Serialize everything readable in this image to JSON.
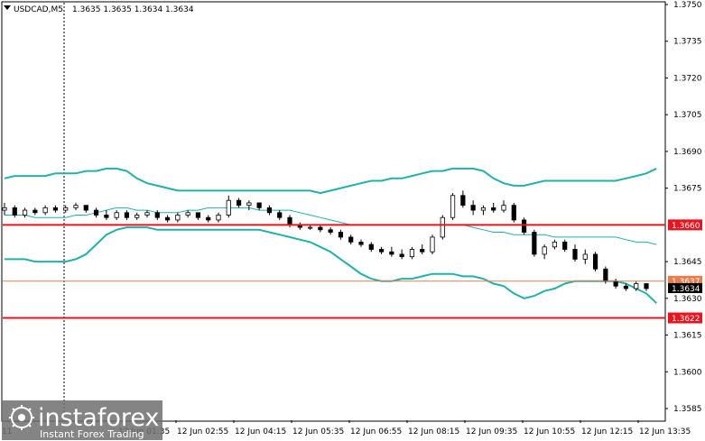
{
  "chart_data": {
    "type": "candlestick",
    "symbol_header": "USDCAD,M5",
    "ohlc_header": "1.3635 1.3635 1.3634 1.3634",
    "y_ticks": [
      "1.3750",
      "1.3735",
      "1.3720",
      "1.3705",
      "1.3690",
      "1.3675",
      "1.3660",
      "1.3645",
      "1.3630",
      "1.3615",
      "1.3600",
      "1.3585"
    ],
    "ylim": [
      1.358,
      1.3752
    ],
    "x_ticks": [
      "12 Jun 02:55",
      "12 Jun 04:15",
      "12 Jun 05:35",
      "12 Jun 06:55",
      "12 Jun 08:15",
      "12 Jun 09:35",
      "12 Jun 10:55",
      "12 Jun 12:15",
      "12 Jun 13:35"
    ],
    "x_ticks_partial": [
      "11",
      "12 Jun 01:35"
    ],
    "levels": [
      {
        "value": 1.366,
        "label": "1.3660",
        "color": "#e8141e"
      },
      {
        "value": 1.3622,
        "label": "1.3622",
        "color": "#e8141e"
      }
    ],
    "current_levels": [
      {
        "value": 1.3637,
        "label": "1.3637",
        "color": "#e67e50"
      },
      {
        "value": 1.3634,
        "label": "1.3634",
        "color": "#000000"
      }
    ],
    "bollinger": {
      "color": "#20b2a8",
      "upper": [
        1.3679,
        1.368,
        1.368,
        1.368,
        1.368,
        1.3681,
        1.3681,
        1.3681,
        1.3682,
        1.3682,
        1.3683,
        1.3683,
        1.3682,
        1.3679,
        1.3677,
        1.3676,
        1.3675,
        1.3674,
        1.3674,
        1.3674,
        1.3674,
        1.3674,
        1.3674,
        1.3674,
        1.3674,
        1.3674,
        1.3674,
        1.3674,
        1.3674,
        1.3674,
        1.3674,
        1.3673,
        1.3674,
        1.3675,
        1.3676,
        1.3677,
        1.3678,
        1.3678,
        1.3679,
        1.3679,
        1.368,
        1.3681,
        1.3682,
        1.3682,
        1.3683,
        1.3683,
        1.3683,
        1.3682,
        1.3679,
        1.3677,
        1.3676,
        1.3676,
        1.3677,
        1.3678,
        1.3678,
        1.3678,
        1.3678,
        1.3678,
        1.3678,
        1.3678,
        1.3678,
        1.3679,
        1.368,
        1.3681,
        1.3683
      ],
      "middle": [
        1.3664,
        1.3664,
        1.3664,
        1.3663,
        1.3663,
        1.3663,
        1.3663,
        1.3664,
        1.3664,
        1.3665,
        1.3666,
        1.3667,
        1.3667,
        1.3666,
        1.3666,
        1.3665,
        1.3665,
        1.3665,
        1.3666,
        1.3666,
        1.3667,
        1.3667,
        1.3667,
        1.3667,
        1.3667,
        1.3666,
        1.3666,
        1.3666,
        1.3666,
        1.3665,
        1.3664,
        1.3663,
        1.3662,
        1.3661,
        1.366,
        1.366,
        1.366,
        1.366,
        1.366,
        1.366,
        1.366,
        1.366,
        1.366,
        1.366,
        1.366,
        1.366,
        1.3659,
        1.3658,
        1.3657,
        1.3657,
        1.3656,
        1.3656,
        1.3656,
        1.3656,
        1.3655,
        1.3655,
        1.3655,
        1.3655,
        1.3655,
        1.3655,
        1.3655,
        1.3654,
        1.3653,
        1.3653,
        1.3652
      ],
      "lower": [
        1.3646,
        1.3646,
        1.3646,
        1.3645,
        1.3645,
        1.3645,
        1.3645,
        1.3646,
        1.3648,
        1.3652,
        1.3656,
        1.3658,
        1.3659,
        1.3659,
        1.3659,
        1.3658,
        1.3658,
        1.3658,
        1.3658,
        1.3658,
        1.3658,
        1.3658,
        1.3658,
        1.3658,
        1.3658,
        1.3658,
        1.3657,
        1.3656,
        1.3655,
        1.3654,
        1.3653,
        1.3651,
        1.3649,
        1.3646,
        1.3643,
        1.364,
        1.3638,
        1.3637,
        1.3637,
        1.3638,
        1.3638,
        1.3639,
        1.364,
        1.364,
        1.364,
        1.3639,
        1.3639,
        1.3638,
        1.3636,
        1.3635,
        1.3632,
        1.363,
        1.3631,
        1.3633,
        1.3634,
        1.3636,
        1.3637,
        1.3637,
        1.3637,
        1.3637,
        1.3637,
        1.3636,
        1.3634,
        1.3632,
        1.3628
      ]
    },
    "candles": [
      [
        1.3666,
        1.3669,
        1.3664,
        1.3667
      ],
      [
        1.3667,
        1.3668,
        1.3663,
        1.3664
      ],
      [
        1.3664,
        1.3667,
        1.3663,
        1.3666
      ],
      [
        1.3666,
        1.3667,
        1.3664,
        1.3665
      ],
      [
        1.3665,
        1.3668,
        1.3664,
        1.3667
      ],
      [
        1.3667,
        1.3668,
        1.3665,
        1.3666
      ],
      [
        1.3666,
        1.3668,
        1.3665,
        1.3667
      ],
      [
        1.3667,
        1.3669,
        1.3666,
        1.3668
      ],
      [
        1.3668,
        1.3668,
        1.3665,
        1.3666
      ],
      [
        1.3666,
        1.3667,
        1.3663,
        1.3664
      ],
      [
        1.3664,
        1.3666,
        1.3662,
        1.3663
      ],
      [
        1.3663,
        1.3666,
        1.3662,
        1.3665
      ],
      [
        1.3665,
        1.3666,
        1.3662,
        1.3663
      ],
      [
        1.3663,
        1.3665,
        1.3662,
        1.3664
      ],
      [
        1.3664,
        1.3666,
        1.3663,
        1.3665
      ],
      [
        1.3665,
        1.3666,
        1.3662,
        1.3663
      ],
      [
        1.3663,
        1.3664,
        1.3661,
        1.3662
      ],
      [
        1.3662,
        1.3665,
        1.3661,
        1.3664
      ],
      [
        1.3664,
        1.3666,
        1.3663,
        1.3665
      ],
      [
        1.3665,
        1.3665,
        1.3662,
        1.3663
      ],
      [
        1.3663,
        1.3664,
        1.3661,
        1.3662
      ],
      [
        1.3662,
        1.3665,
        1.3661,
        1.3664
      ],
      [
        1.3664,
        1.3672,
        1.3663,
        1.367
      ],
      [
        1.367,
        1.3671,
        1.3667,
        1.3668
      ],
      [
        1.3668,
        1.367,
        1.3666,
        1.3669
      ],
      [
        1.3669,
        1.3669,
        1.3666,
        1.3667
      ],
      [
        1.3667,
        1.3668,
        1.3664,
        1.3665
      ],
      [
        1.3665,
        1.3666,
        1.3662,
        1.3663
      ],
      [
        1.3663,
        1.3664,
        1.3659,
        1.366
      ],
      [
        1.366,
        1.3661,
        1.3658,
        1.3659
      ],
      [
        1.3659,
        1.366,
        1.3658,
        1.3659
      ],
      [
        1.3659,
        1.366,
        1.3657,
        1.3658
      ],
      [
        1.3658,
        1.3659,
        1.3656,
        1.3657
      ],
      [
        1.3657,
        1.3658,
        1.3654,
        1.3655
      ],
      [
        1.3655,
        1.3656,
        1.3652,
        1.3653
      ],
      [
        1.3653,
        1.3654,
        1.3651,
        1.3652
      ],
      [
        1.3652,
        1.3653,
        1.3649,
        1.365
      ],
      [
        1.365,
        1.3651,
        1.3648,
        1.3649
      ],
      [
        1.3649,
        1.3651,
        1.3647,
        1.3648
      ],
      [
        1.3648,
        1.365,
        1.3646,
        1.3647
      ],
      [
        1.3647,
        1.3651,
        1.3646,
        1.365
      ],
      [
        1.365,
        1.3652,
        1.3648,
        1.3649
      ],
      [
        1.3649,
        1.3656,
        1.3648,
        1.3655
      ],
      [
        1.3655,
        1.3664,
        1.3654,
        1.3663
      ],
      [
        1.3663,
        1.3673,
        1.3662,
        1.3672
      ],
      [
        1.3672,
        1.3674,
        1.3667,
        1.3668
      ],
      [
        1.3668,
        1.367,
        1.3664,
        1.3666
      ],
      [
        1.3666,
        1.3668,
        1.3664,
        1.3667
      ],
      [
        1.3667,
        1.3669,
        1.3665,
        1.3666
      ],
      [
        1.3666,
        1.367,
        1.3665,
        1.3668
      ],
      [
        1.3668,
        1.3669,
        1.3661,
        1.3662
      ],
      [
        1.3662,
        1.3663,
        1.3656,
        1.3657
      ],
      [
        1.3657,
        1.3658,
        1.3647,
        1.3648
      ],
      [
        1.3648,
        1.3652,
        1.3646,
        1.3651
      ],
      [
        1.3651,
        1.3654,
        1.365,
        1.3653
      ],
      [
        1.3653,
        1.3654,
        1.3649,
        1.365
      ],
      [
        1.365,
        1.3652,
        1.3645,
        1.3646
      ],
      [
        1.3646,
        1.365,
        1.3644,
        1.3648
      ],
      [
        1.3648,
        1.3649,
        1.3641,
        1.3642
      ],
      [
        1.3642,
        1.3643,
        1.3636,
        1.3637
      ],
      [
        1.3637,
        1.3638,
        1.3634,
        1.3635
      ],
      [
        1.3635,
        1.3636,
        1.3633,
        1.3634
      ],
      [
        1.3634,
        1.3637,
        1.3633,
        1.3636
      ],
      [
        1.3636,
        1.3636,
        1.3633,
        1.3634
      ]
    ],
    "bull_color": "#ffffff",
    "bear_color": "#000000"
  },
  "watermark": {
    "title": "instaforex",
    "subtitle": "Instant Forex Trading"
  }
}
